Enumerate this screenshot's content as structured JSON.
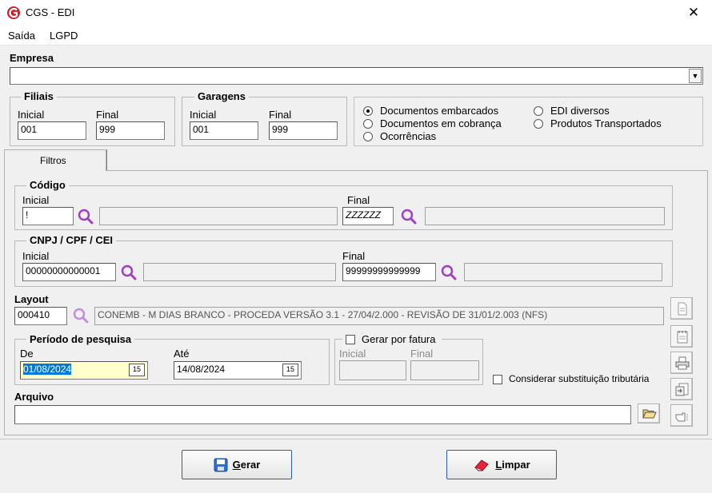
{
  "window": {
    "title": "CGS - EDI",
    "close_symbol": "✕"
  },
  "menu": {
    "items": [
      "Saída",
      "LGPD"
    ]
  },
  "empresa": {
    "label": "Empresa",
    "value": ""
  },
  "filiais": {
    "title": "Filiais",
    "inicial_label": "Inicial",
    "final_label": "Final",
    "inicial_value": "001",
    "final_value": "999"
  },
  "garagens": {
    "title": "Garagens",
    "inicial_label": "Inicial",
    "final_label": "Final",
    "inicial_value": "001",
    "final_value": "999"
  },
  "options": {
    "documentos_embarcados": "Documentos embarcados",
    "documentos_em_cobranca": "Documentos em cobrança",
    "ocorrencias": "Ocorrências",
    "edi_diversos": "EDI diversos",
    "produtos_transportados": "Produtos Transportados",
    "selected": "documentos_embarcados"
  },
  "tabs": {
    "filtros": "Filtros"
  },
  "codigo": {
    "title": "Código",
    "inicial_label": "Inicial",
    "final_label": "Final",
    "inicial_value": "!",
    "final_value": "ZZZZZZ",
    "inicial_desc": "",
    "final_desc": ""
  },
  "cnpj": {
    "title": "CNPJ / CPF / CEI",
    "inicial_label": "Inicial",
    "final_label": "Final",
    "inicial_value": "00000000000001",
    "final_value": "99999999999999",
    "inicial_desc": "",
    "final_desc": ""
  },
  "layout": {
    "label": "Layout",
    "code": "000410",
    "description": "CONEMB - M DIAS BRANCO - PROCEDA VERSÃO 3.1 - 27/04/2.000 - REVISÃO DE 31/01/2.003 (NFS)"
  },
  "periodo": {
    "title": "Período de pesquisa",
    "de_label": "De",
    "ate_label": "Até",
    "de_value": "01/08/2024",
    "ate_value": "14/08/2024",
    "cal_text": "15"
  },
  "gerar_por_fatura": {
    "label": "Gerar por fatura",
    "inicial_label": "Inicial",
    "final_label": "Final",
    "checked": false
  },
  "substituicao": {
    "label": "Considerar substituição tributária",
    "checked": false
  },
  "arquivo": {
    "label": "Arquivo",
    "value": ""
  },
  "actions": {
    "gerar_rest": "erar",
    "gerar_accel": "G",
    "limpar_rest": "impar",
    "limpar_accel": "L"
  },
  "colors": {
    "accent": "#2d5db3",
    "magnifier": "#a040c0",
    "highlight": "#0078d7",
    "date_bg": "#ffffcc"
  }
}
